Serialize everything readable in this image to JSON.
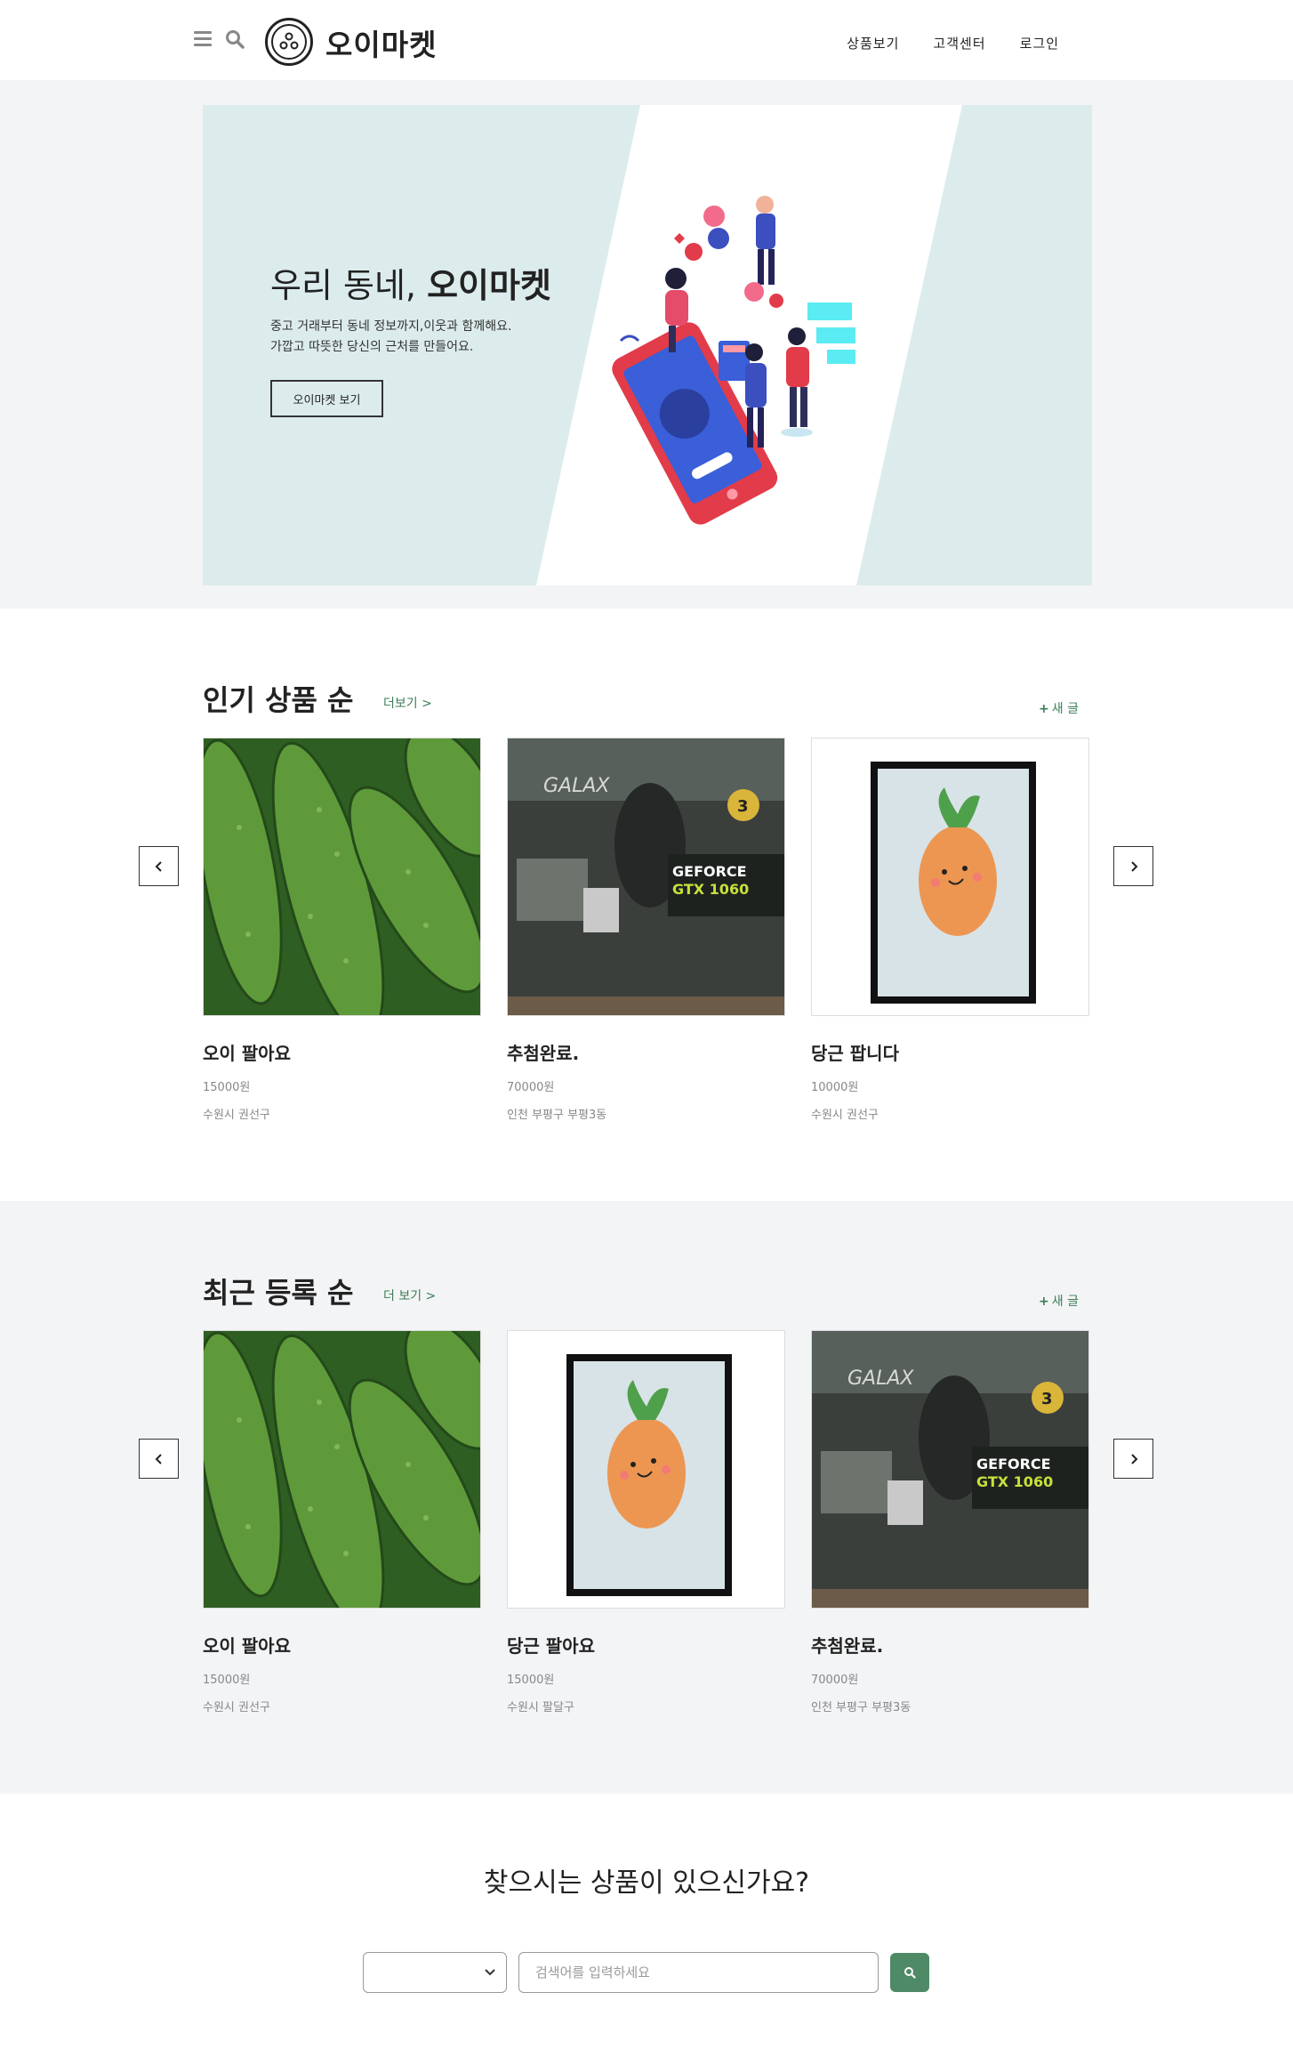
{
  "header": {
    "brand": "오이마켓",
    "nav": [
      "상품보기",
      "고객센터",
      "로그인"
    ]
  },
  "hero": {
    "title_plain": "우리 동네, ",
    "title_bold": "오이마켓",
    "desc_line1": "중고 거래부터 동네 정보까지,이웃과 함께해요.",
    "desc_line2": "가깝고 따뜻한 당신의 근처를 만들어요.",
    "button": "오이마켓 보기"
  },
  "popular": {
    "title": "인기 상품 순",
    "more": "더보기 >",
    "new_post": "새 글",
    "items": [
      {
        "title": "오이 팔아요",
        "price": "15000원",
        "location": "수원시 권선구",
        "image": "cucumber"
      },
      {
        "title": "추첨완료.",
        "price": "70000원",
        "location": "인천 부평구 부평3동",
        "image": "gpu-box"
      },
      {
        "title": "당근 팝니다",
        "price": "10000원",
        "location": "수원시 권선구",
        "image": "carrot-poster"
      }
    ]
  },
  "recent": {
    "title": "최근 등록 순",
    "more": "더 보기 >",
    "new_post": "새 글",
    "items": [
      {
        "title": "오이 팔아요",
        "price": "15000원",
        "location": "수원시 권선구",
        "image": "cucumber"
      },
      {
        "title": "당근 팔아요",
        "price": "15000원",
        "location": "수원시 팔달구",
        "image": "carrot-poster"
      },
      {
        "title": "추첨완료.",
        "price": "70000원",
        "location": "인천 부평구 부평3동",
        "image": "gpu-box"
      }
    ]
  },
  "search": {
    "title": "찾으시는 상품이 있으신가요?",
    "select_value": "",
    "placeholder": "검색어를 입력하세요"
  },
  "colors": {
    "accent_green": "#4e8a66",
    "link_green": "#3b7d55",
    "hero_bg": "#dcecec",
    "section_gray": "#f3f4f6"
  }
}
